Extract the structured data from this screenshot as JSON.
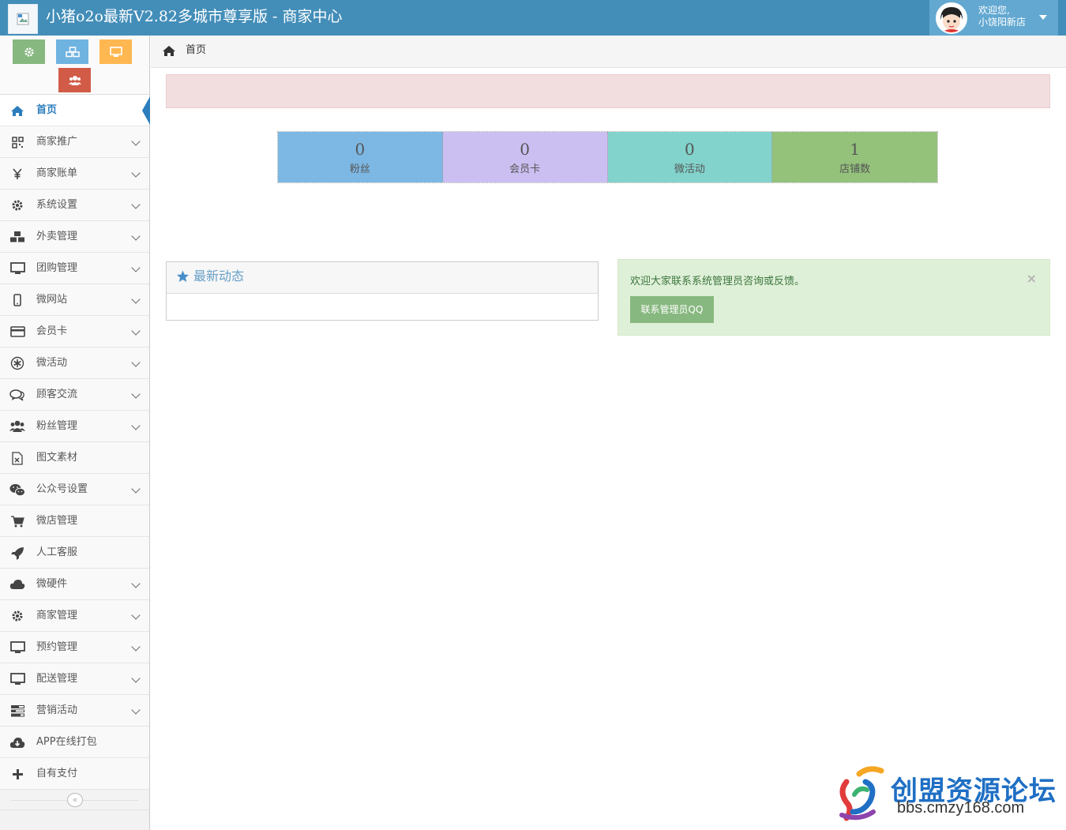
{
  "header": {
    "title": "小猪o2o最新V2.82多城市尊享版 - 商家中心",
    "greeting": "欢迎您,",
    "username": "小饶阳新店"
  },
  "shortcuts": [
    {
      "icon": "gear-icon",
      "color": "#87b87f"
    },
    {
      "icon": "cubes-icon",
      "color": "#6fb3e0"
    },
    {
      "icon": "desktop-icon",
      "color": "#ffb752"
    },
    {
      "icon": "users-icon",
      "color": "#d15b47"
    }
  ],
  "sidebar": {
    "items": [
      {
        "label": "首页",
        "icon": "home-icon",
        "arrow": false,
        "active": true
      },
      {
        "label": "商家推广",
        "icon": "qrcode-icon",
        "arrow": true
      },
      {
        "label": "商家账单",
        "icon": "yen-icon",
        "arrow": true
      },
      {
        "label": "系统设置",
        "icon": "gear-icon",
        "arrow": true
      },
      {
        "label": "外卖管理",
        "icon": "cubes-icon",
        "arrow": true
      },
      {
        "label": "团购管理",
        "icon": "desktop-icon",
        "arrow": true
      },
      {
        "label": "微网站",
        "icon": "mobile-icon",
        "arrow": true
      },
      {
        "label": "会员卡",
        "icon": "credit-card-icon",
        "arrow": true
      },
      {
        "label": "微活动",
        "icon": "asterisk-icon",
        "arrow": true
      },
      {
        "label": "顾客交流",
        "icon": "comments-icon",
        "arrow": true
      },
      {
        "label": "粉丝管理",
        "icon": "users-icon",
        "arrow": true
      },
      {
        "label": "图文素材",
        "icon": "file-excel-icon",
        "arrow": false
      },
      {
        "label": "公众号设置",
        "icon": "wechat-icon",
        "arrow": true
      },
      {
        "label": "微店管理",
        "icon": "cart-icon",
        "arrow": false
      },
      {
        "label": "人工客服",
        "icon": "rocket-icon",
        "arrow": false
      },
      {
        "label": "微硬件",
        "icon": "cloud-icon",
        "arrow": true
      },
      {
        "label": "商家管理",
        "icon": "gear-icon",
        "arrow": true
      },
      {
        "label": "预约管理",
        "icon": "desktop-icon",
        "arrow": true
      },
      {
        "label": "配送管理",
        "icon": "desktop-icon",
        "arrow": true
      },
      {
        "label": "营销活动",
        "icon": "tasks-icon",
        "arrow": true
      },
      {
        "label": "APP在线打包",
        "icon": "cloud-download-icon",
        "arrow": false
      },
      {
        "label": "自有支付",
        "icon": "plus-icon",
        "arrow": false
      }
    ],
    "collapse_icon": "«"
  },
  "breadcrumb": {
    "label": "首页"
  },
  "stats": [
    {
      "value": "0",
      "label": "粉丝",
      "color": "#7db8e4"
    },
    {
      "value": "0",
      "label": "会员卡",
      "color": "#cbbff2"
    },
    {
      "value": "0",
      "label": "微活动",
      "color": "#82d3cc"
    },
    {
      "value": "1",
      "label": "店铺数",
      "color": "#94c27b"
    }
  ],
  "widget": {
    "title": "最新动态"
  },
  "notice": {
    "text": "欢迎大家联系系统管理员咨询或反馈。",
    "close": "×",
    "button": "联系管理员QQ"
  },
  "watermark": {
    "title": "创盟资源论坛",
    "url": "bbs.cmzy168.com"
  }
}
